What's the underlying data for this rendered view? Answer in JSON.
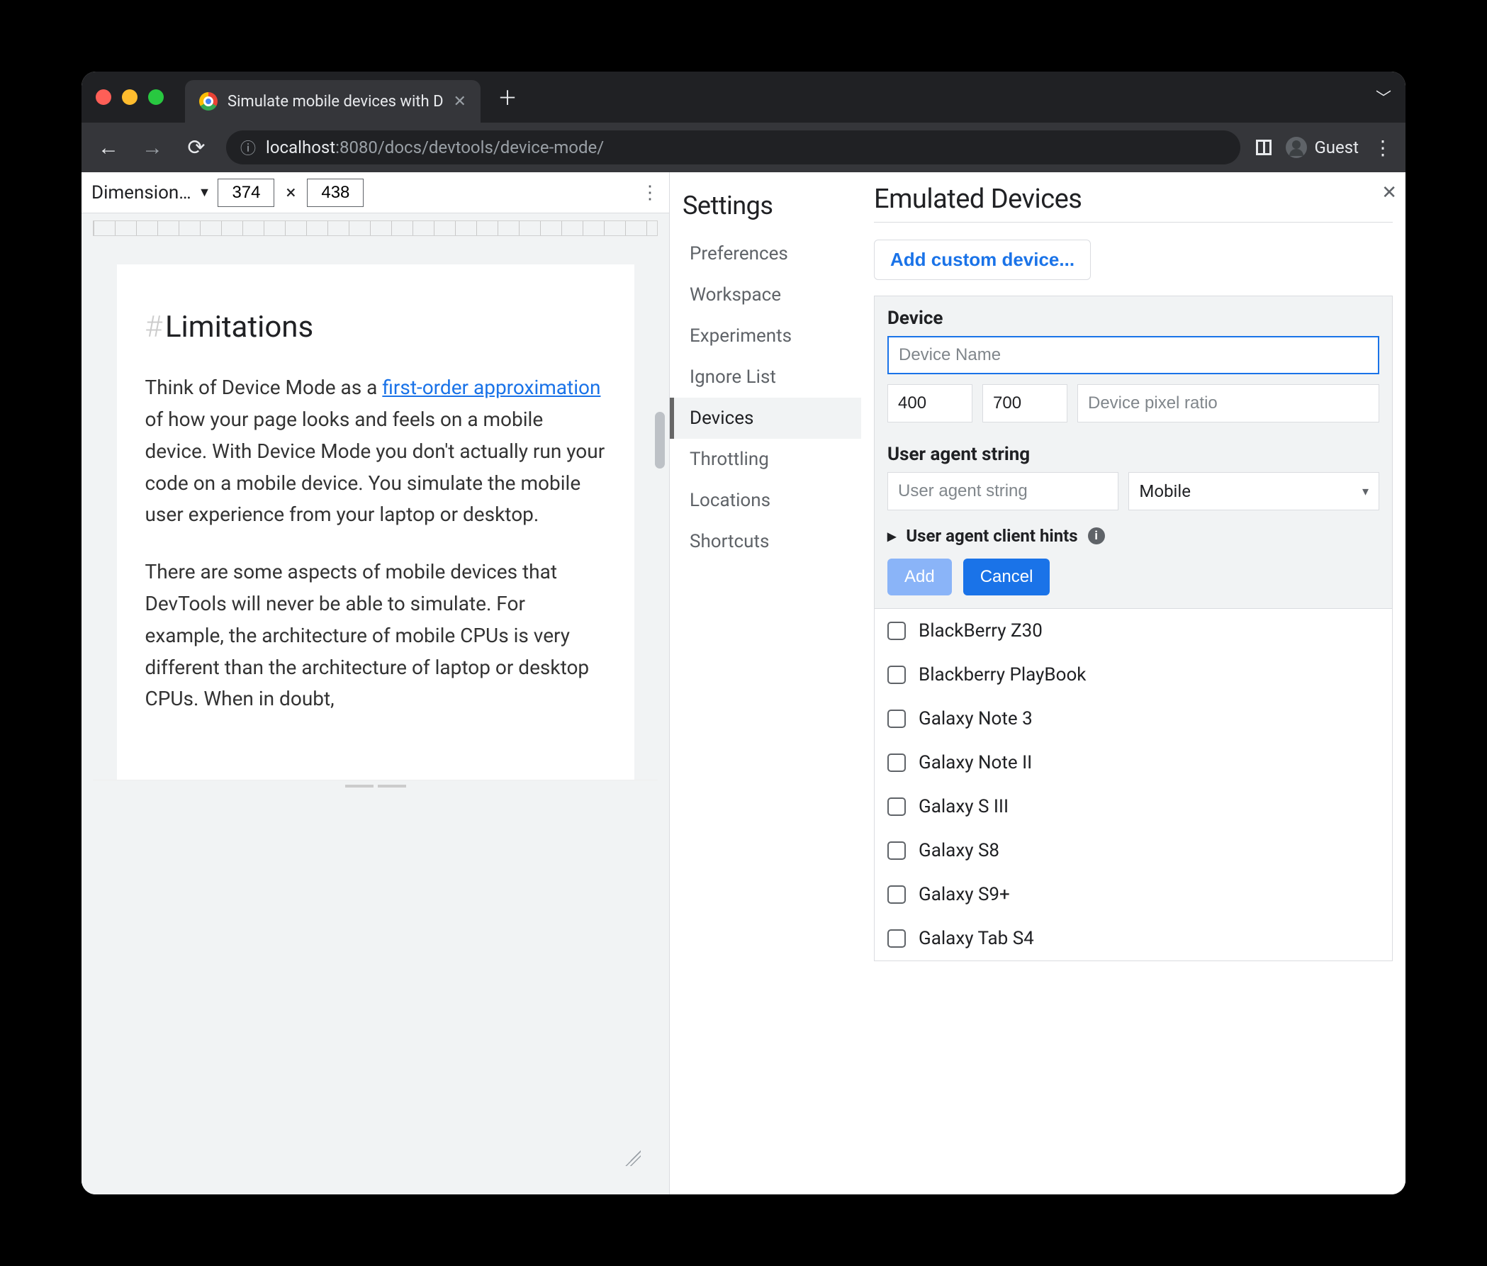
{
  "tab": {
    "title": "Simulate mobile devices with D"
  },
  "omnibox": {
    "host": "localhost",
    "port": ":8080",
    "path": "/docs/devtools/device-mode/"
  },
  "profile": {
    "label": "Guest"
  },
  "device_toolbar": {
    "dimensions_label": "Dimension…",
    "width": "374",
    "height": "438"
  },
  "page": {
    "heading": "Limitations",
    "p1_pre": "Think of Device Mode as a ",
    "p1_link": "first-order approximation",
    "p1_post": " of how your page looks and feels on a mobile device. With Device Mode you don't actually run your code on a mobile device. You simulate the mobile user experience from your laptop or desktop.",
    "p2": "There are some aspects of mobile devices that DevTools will never be able to simulate. For example, the architecture of mobile CPUs is very different than the architecture of laptop or desktop CPUs. When in doubt,"
  },
  "settings": {
    "title": "Settings",
    "nav": [
      "Preferences",
      "Workspace",
      "Experiments",
      "Ignore List",
      "Devices",
      "Throttling",
      "Locations",
      "Shortcuts"
    ],
    "selected": "Devices"
  },
  "emulated": {
    "title": "Emulated Devices",
    "add_custom_label": "Add custom device...",
    "device_label": "Device",
    "name_placeholder": "Device Name",
    "width_value": "400",
    "height_value": "700",
    "dpr_placeholder": "Device pixel ratio",
    "ua_label": "User agent string",
    "ua_placeholder": "User agent string",
    "ua_type": "Mobile",
    "client_hints_label": "User agent client hints",
    "add_btn": "Add",
    "cancel_btn": "Cancel",
    "devices": [
      "BlackBerry Z30",
      "Blackberry PlayBook",
      "Galaxy Note 3",
      "Galaxy Note II",
      "Galaxy S III",
      "Galaxy S8",
      "Galaxy S9+",
      "Galaxy Tab S4"
    ]
  }
}
